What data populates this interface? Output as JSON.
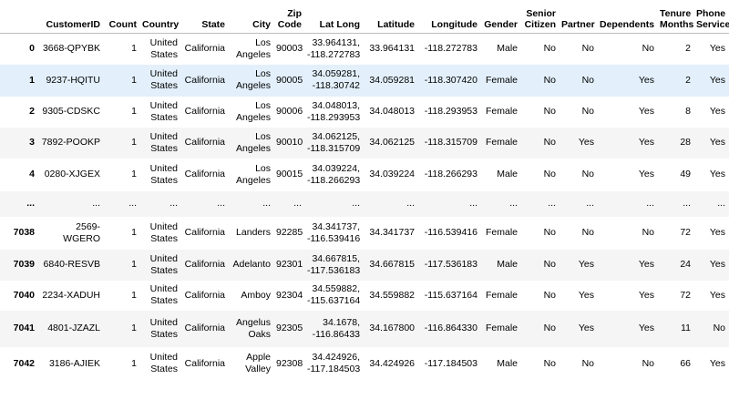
{
  "columns": [
    "",
    "CustomerID",
    "Count",
    "Country",
    "State",
    "City",
    "Zip Code",
    "Lat Long",
    "Latitude",
    "Longitude",
    "Gender",
    "Senior Citizen",
    "Partner",
    "Dependents",
    "Tenure Months",
    "Phone Service"
  ],
  "rows": [
    [
      "0",
      "3668-QPYBK",
      "1",
      "United States",
      "California",
      "Los Angeles",
      "90003",
      "33.964131, -118.272783",
      "33.964131",
      "-118.272783",
      "Male",
      "No",
      "No",
      "No",
      "2",
      "Yes"
    ],
    [
      "1",
      "9237-HQITU",
      "1",
      "United States",
      "California",
      "Los Angeles",
      "90005",
      "34.059281, -118.30742",
      "34.059281",
      "-118.307420",
      "Female",
      "No",
      "No",
      "Yes",
      "2",
      "Yes"
    ],
    [
      "2",
      "9305-CDSKC",
      "1",
      "United States",
      "California",
      "Los Angeles",
      "90006",
      "34.048013, -118.293953",
      "34.048013",
      "-118.293953",
      "Female",
      "No",
      "No",
      "Yes",
      "8",
      "Yes"
    ],
    [
      "3",
      "7892-POOKP",
      "1",
      "United States",
      "California",
      "Los Angeles",
      "90010",
      "34.062125, -118.315709",
      "34.062125",
      "-118.315709",
      "Female",
      "No",
      "Yes",
      "Yes",
      "28",
      "Yes"
    ],
    [
      "4",
      "0280-XJGEX",
      "1",
      "United States",
      "California",
      "Los Angeles",
      "90015",
      "34.039224, -118.266293",
      "34.039224",
      "-118.266293",
      "Male",
      "No",
      "No",
      "Yes",
      "49",
      "Yes"
    ],
    [
      "...",
      "...",
      "...",
      "...",
      "...",
      "...",
      "...",
      "...",
      "...",
      "...",
      "...",
      "...",
      "...",
      "...",
      "...",
      "..."
    ],
    [
      "7038",
      "2569-WGERO",
      "1",
      "United States",
      "California",
      "Landers",
      "92285",
      "34.341737, -116.539416",
      "34.341737",
      "-116.539416",
      "Female",
      "No",
      "No",
      "No",
      "72",
      "Yes"
    ],
    [
      "7039",
      "6840-RESVB",
      "1",
      "United States",
      "California",
      "Adelanto",
      "92301",
      "34.667815, -117.536183",
      "34.667815",
      "-117.536183",
      "Male",
      "No",
      "Yes",
      "Yes",
      "24",
      "Yes"
    ],
    [
      "7040",
      "2234-XADUH",
      "1",
      "United States",
      "California",
      "Amboy",
      "92304",
      "34.559882, -115.637164",
      "34.559882",
      "-115.637164",
      "Female",
      "No",
      "Yes",
      "Yes",
      "72",
      "Yes"
    ],
    [
      "7041",
      "4801-JZAZL",
      "1",
      "United States",
      "California",
      "Angelus Oaks",
      "92305",
      "34.1678, -116.86433",
      "34.167800",
      "-116.864330",
      "Female",
      "No",
      "Yes",
      "Yes",
      "11",
      "No"
    ],
    [
      "7042",
      "3186-AJIEK",
      "1",
      "United States",
      "California",
      "Apple Valley",
      "92308",
      "34.424926, -117.184503",
      "34.424926",
      "-117.184503",
      "Male",
      "No",
      "No",
      "No",
      "66",
      "Yes"
    ]
  ]
}
